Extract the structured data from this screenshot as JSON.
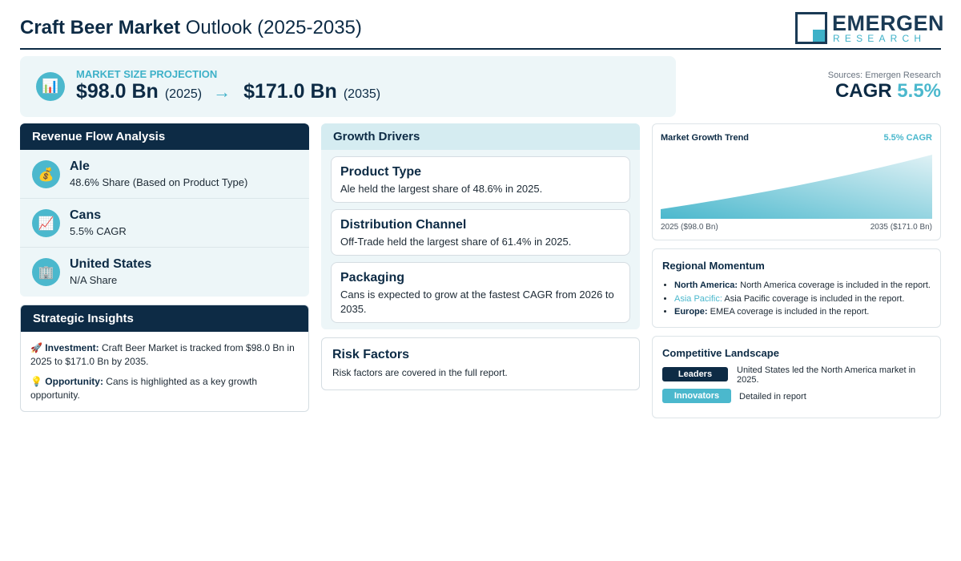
{
  "header": {
    "title_bold": "Craft Beer Market",
    "title_rest": "Outlook (2025-2035)",
    "logo_word": "EMERGEN",
    "logo_sub": "RESEARCH"
  },
  "projection": {
    "icon": "bar-chart-icon",
    "label": "MARKET SIZE PROJECTION",
    "start_value": "$98.0 Bn",
    "start_year": "(2025)",
    "arrow": "→",
    "end_value": "$171.0 Bn",
    "end_year": "(2035)"
  },
  "sources": "Sources: Emergen Research",
  "cagr": {
    "label": "CAGR",
    "value": "5.5%"
  },
  "revenue": {
    "heading": "Revenue Flow Analysis",
    "items": [
      {
        "icon": "money-bag-icon",
        "glyph": "💰",
        "title": "Ale",
        "sub": "48.6% Share (Based on Product Type)"
      },
      {
        "icon": "chart-up-icon",
        "glyph": "📈",
        "title": "Cans",
        "sub": "5.5% CAGR"
      },
      {
        "icon": "building-icon",
        "glyph": "🏢",
        "title": "United States",
        "sub": "N/A Share"
      }
    ]
  },
  "insights": {
    "heading": "Strategic Insights",
    "investment_icon": "🚀",
    "investment_label": "Investment:",
    "investment_text": "Craft Beer Market is tracked from $98.0 Bn in 2025 to $171.0 Bn by 2035.",
    "opportunity_icon": "💡",
    "opportunity_label": "Opportunity:",
    "opportunity_text": "Cans is highlighted as a key growth opportunity."
  },
  "drivers": {
    "heading": "Growth Drivers",
    "items": [
      {
        "title": "Product Type",
        "text": "Ale held the largest share of 48.6% in 2025."
      },
      {
        "title": "Distribution Channel",
        "text": "Off-Trade held the largest share of 61.4% in 2025."
      },
      {
        "title": "Packaging",
        "text": "Cans is expected to grow at the fastest CAGR from 2026 to 2035."
      }
    ]
  },
  "risk": {
    "title": "Risk Factors",
    "text": "Risk factors are covered in the full report."
  },
  "trend": {
    "title": "Market Growth Trend",
    "cagr": "5.5% CAGR",
    "left_label": "2025 ($98.0 Bn)",
    "right_label": "2035 ($171.0 Bn)",
    "start_value": 98.0,
    "end_value": 171.0
  },
  "regional": {
    "title": "Regional Momentum",
    "items": [
      {
        "region": "North America:",
        "text": "North America coverage is included in the report."
      },
      {
        "region": "Asia Pacific:",
        "text": "Asia Pacific coverage is included in the report."
      },
      {
        "region": "Europe:",
        "text": "EMEA coverage is included in the report."
      }
    ]
  },
  "competitive": {
    "title": "Competitive Landscape",
    "leaders_label": "Leaders",
    "leaders_text": "United States led the North America market in 2025.",
    "innovators_label": "Innovators",
    "innovators_text": "Detailed in report"
  },
  "colors": {
    "navy": "#0d2b45",
    "teal": "#4bb8cd",
    "light_panel": "#edf6f8"
  }
}
